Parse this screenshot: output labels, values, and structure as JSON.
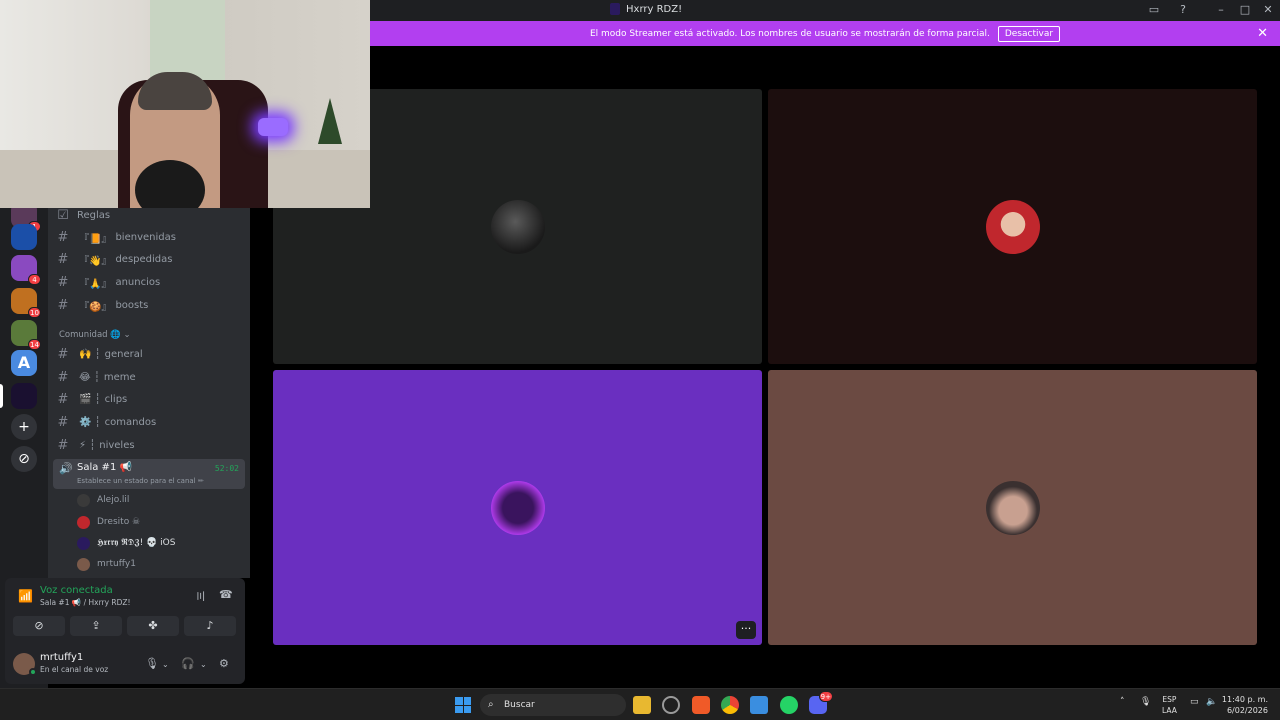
{
  "window": {
    "title": "Hxrry RDZ!",
    "controls": [
      "inbox-icon",
      "help-icon",
      "minimize-icon",
      "maximize-icon",
      "close-icon"
    ]
  },
  "banner": {
    "message": "El modo Streamer está activado. Los nombres de usuario se mostrarán de forma parcial.",
    "button_label": "Desactivar",
    "color": "#b23ff0"
  },
  "servers": [
    {
      "badge": "1"
    },
    {
      "badge": ""
    },
    {
      "badge": "4"
    },
    {
      "badge": "10"
    },
    {
      "badge": "14"
    },
    {
      "badge": ""
    },
    {
      "badge": ""
    }
  ],
  "sidebar": {
    "top_channel": "Reglas",
    "channels": [
      {
        "name": "bienvenidas",
        "prefix": "『📙』"
      },
      {
        "name": "despedidas",
        "prefix": "『👋』"
      },
      {
        "name": "anuncios",
        "prefix": "『🙏』"
      },
      {
        "name": "boosts",
        "prefix": "『🍪』"
      }
    ],
    "category": "Comunidad 🌐",
    "community_channels": [
      {
        "name": "general",
        "prefix": "🙌 ┆"
      },
      {
        "name": "meme",
        "prefix": "😂 ┆"
      },
      {
        "name": "clips",
        "prefix": "🎬 ┆"
      },
      {
        "name": "comandos",
        "prefix": "⚙️ ┆"
      },
      {
        "name": "niveles",
        "prefix": "⚡ ┆"
      }
    ],
    "voice_channel": {
      "name": "Sala #1 📢",
      "status": "Establece un estado para el canal ✏",
      "timer": "52:02"
    },
    "voice_users": [
      {
        "name": "Alejo.lil",
        "color": "#3a3a3a"
      },
      {
        "name": "Dresito ☠",
        "color": "#c0272d"
      },
      {
        "name": "𝕳𝖝𝖗𝖗𝖞 𝕽𝕯𝖅! 💀 iOS",
        "color": "#2a1a5e"
      },
      {
        "name": "mrtuffy1",
        "color": "#7a5a4a"
      }
    ]
  },
  "voice_panel": {
    "title": "Voz conectada",
    "subtitle": "Sala #1 📢 / Hxrry RDZ!",
    "buttons": [
      "camera-off-icon",
      "screen-share-icon",
      "activities-icon",
      "soundboard-icon"
    ]
  },
  "user": {
    "name": "mrtuffy1",
    "status": "En el canal de voz"
  },
  "stage": {
    "tiles": [
      {
        "bg": "#1f2120",
        "avatar_color": "#2b2b2b"
      },
      {
        "bg": "#1c0e0e",
        "avatar_color": "#c0272d"
      },
      {
        "bg": "#6a2fc0",
        "avatar_color": "#3a145e"
      },
      {
        "bg": "#6b4a42",
        "avatar_color": "#8a6a5c"
      }
    ],
    "more_label": "···"
  },
  "taskbar": {
    "search_placeholder": "Buscar",
    "lang_line1": "ESP",
    "lang_line2": "LAA",
    "time": "11:40 p. m.",
    "date": "6/02/2026",
    "discord_badge": "9+"
  }
}
